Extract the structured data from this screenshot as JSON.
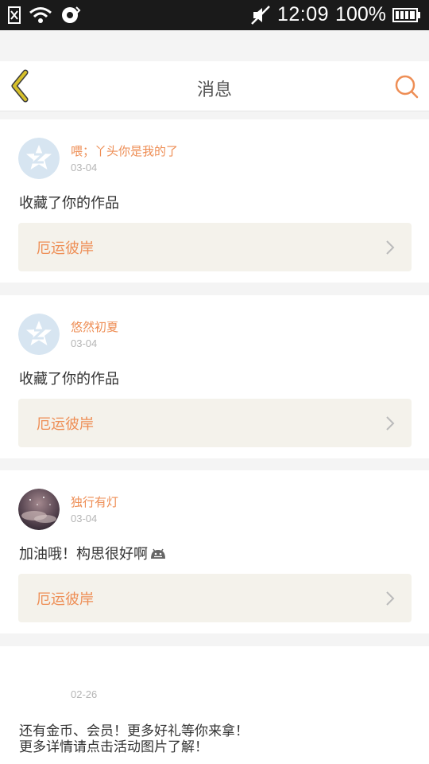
{
  "status_bar": {
    "time": "12:09",
    "battery": "100%",
    "icons": [
      "sim-off-icon",
      "wifi-icon",
      "sync-icon",
      "mute-icon",
      "battery-icon"
    ]
  },
  "header": {
    "title": "消息",
    "back_icon": "chevron-left-icon",
    "search_icon": "search-icon"
  },
  "messages": [
    {
      "username": "喂；丫头你是我的了",
      "date": "03-04",
      "text": "收藏了你的作品",
      "work": "厄运彼岸",
      "avatar": "default-avatar"
    },
    {
      "username": "悠然初夏",
      "date": "03-04",
      "text": "收藏了你的作品",
      "work": "厄运彼岸",
      "avatar": "default-avatar"
    },
    {
      "username": "独行有灯",
      "date": "03-04",
      "text": "加油哦！构思很好啊",
      "work": "厄运彼岸",
      "avatar": "photo-avatar"
    }
  ],
  "promo": {
    "date": "02-26",
    "line1": "还有金币、会员！更多好礼等你来拿！",
    "line2": "更多详情请点击活动图片了解！"
  },
  "colors": {
    "accent": "#ee8e55",
    "back_icon": "#c8b020",
    "link_bg": "#f4f2eb"
  }
}
